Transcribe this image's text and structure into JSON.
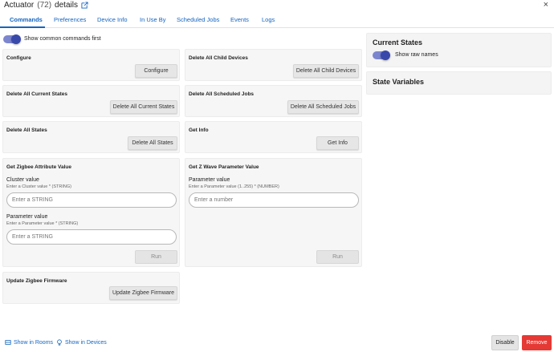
{
  "header": {
    "device_name": "Actuator",
    "device_id": "(72)",
    "suffix": "details",
    "close_glyph": "×"
  },
  "tabs": [
    {
      "label": "Commands"
    },
    {
      "label": "Preferences"
    },
    {
      "label": "Device Info"
    },
    {
      "label": "In Use By"
    },
    {
      "label": "Scheduled Jobs"
    },
    {
      "label": "Events"
    },
    {
      "label": "Logs"
    }
  ],
  "commands": {
    "show_common_label": "Show common commands first",
    "show_common_on": true,
    "cards": {
      "configure": {
        "title": "Configure",
        "button": "Configure"
      },
      "delete_child": {
        "title": "Delete All Child Devices",
        "button": "Delete All Child Devices"
      },
      "delete_current": {
        "title": "Delete All Current States",
        "button": "Delete All Current States"
      },
      "delete_scheduled": {
        "title": "Delete All Scheduled Jobs",
        "button": "Delete All Scheduled Jobs"
      },
      "delete_states": {
        "title": "Delete All States",
        "button": "Delete All States"
      },
      "get_info": {
        "title": "Get Info",
        "button": "Get Info"
      },
      "get_zigbee": {
        "title": "Get Zigbee Attribute Value",
        "cluster_label": "Cluster value",
        "cluster_hint": "Enter a Cluster value * (STRING)",
        "cluster_placeholder": "Enter a STRING",
        "param_label": "Parameter value",
        "param_hint": "Enter a Parameter value * (STRING)",
        "param_placeholder": "Enter a STRING",
        "button": "Run"
      },
      "get_zwave": {
        "title": "Get Z Wave Parameter Value",
        "param_label": "Parameter value",
        "param_hint": "Enter a Parameter value (1..255) * (NUMBER)",
        "param_placeholder": "Enter a number",
        "button": "Run"
      },
      "update_firmware": {
        "title": "Update Zigbee Firmware",
        "button": "Update Zigbee Firmware"
      }
    }
  },
  "side": {
    "current_states_title": "Current States",
    "raw_names_label": "Show raw names",
    "raw_names_on": true,
    "state_variables_title": "State Variables"
  },
  "footer": {
    "show_in_rooms": "Show in Rooms",
    "show_in_devices": "Show in Devices",
    "disable": "Disable",
    "remove": "Remove"
  },
  "colors": {
    "accent": "#1565c0",
    "toggle": "#3949ab",
    "danger": "#e53935"
  }
}
